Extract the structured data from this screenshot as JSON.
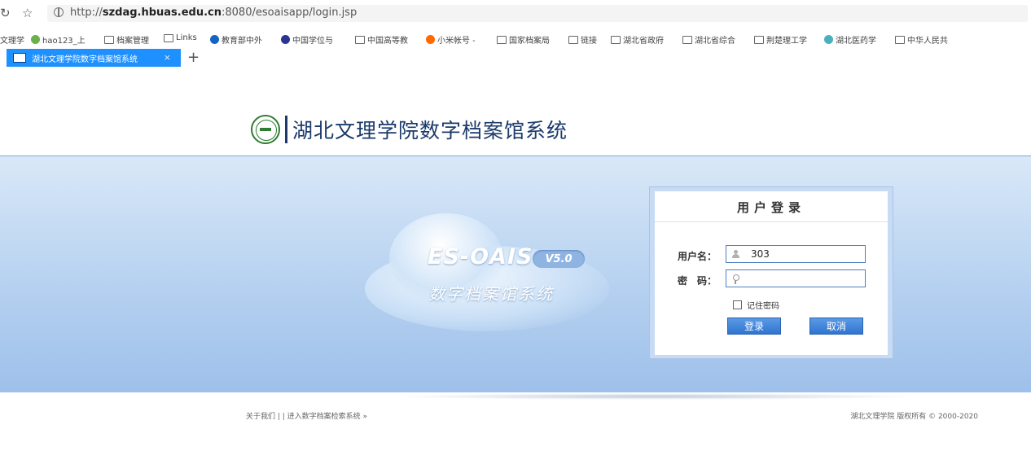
{
  "browser": {
    "url_prefix": "http://",
    "url_host": "szdag.hbuas.edu.cn",
    "url_rest": ":8080/esoaisapp/login.jsp",
    "bookmarks": [
      {
        "label": "文理学",
        "icon": "site-icon"
      },
      {
        "label": "hao123_上",
        "icon": "hao123-icon"
      },
      {
        "label": "档案管理",
        "icon": "folder-icon"
      },
      {
        "label": "Links",
        "icon": "folder-icon"
      },
      {
        "label": "教育部中外",
        "icon": "moe-icon"
      },
      {
        "label": "中国学位与",
        "icon": "grad-cap-icon"
      },
      {
        "label": "中国高等教",
        "icon": "page-icon"
      },
      {
        "label": "小米帐号 -",
        "icon": "mi-icon"
      },
      {
        "label": "国家档案局",
        "icon": "page-icon"
      },
      {
        "label": "链接",
        "icon": "folder-icon"
      },
      {
        "label": "湖北省政府",
        "icon": "page-icon"
      },
      {
        "label": "湖北省综合",
        "icon": "page-icon"
      },
      {
        "label": "荆楚理工学",
        "icon": "page-icon"
      },
      {
        "label": "湖北医药学",
        "icon": "hbmu-icon"
      },
      {
        "label": "中华人民共",
        "icon": "page-icon"
      }
    ],
    "tab": {
      "title": "湖北文理学院数字档案馆系统",
      "close": "×"
    },
    "new_tab": "+"
  },
  "header": {
    "title": "湖北文理学院数字档案馆系统"
  },
  "hero": {
    "product": "ES-OAIS",
    "version": "V5.0",
    "subtitle": "数字档案馆系统"
  },
  "login": {
    "heading": "用户登录",
    "username_label": "用户名：",
    "username_value": "303",
    "password_label": "密　码：",
    "password_value": "",
    "remember_label": "记住密码",
    "remember_checked": false,
    "submit_label": "登录",
    "cancel_label": "取消"
  },
  "footer": {
    "links": "关于我们 |  | 进入数字档案检索系统 »",
    "copyright": "湖北文理学院 版权所有 © 2000-2020"
  },
  "colors": {
    "accent": "#1e90ff",
    "brand": "#1b3a6b",
    "button": "#2f74cf"
  }
}
